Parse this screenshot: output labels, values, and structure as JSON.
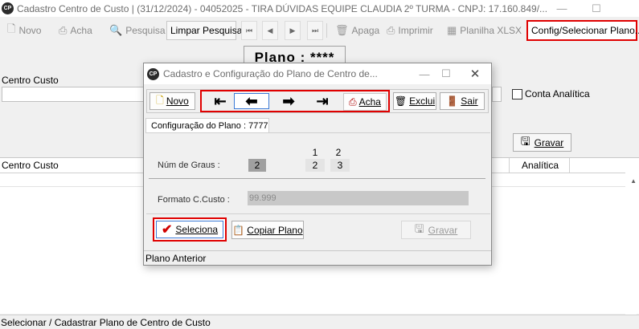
{
  "window": {
    "title": "Cadastro Centro de Custo | (31/12/2024) - 04052025 - TIRA DÚVIDAS EQUIPE CLAUDIA 2º TURMA   - CNPJ: 17.160.849/...",
    "minimize": "—",
    "maximize": "☐",
    "logo": "CP"
  },
  "toolbar": {
    "novo": "Novo",
    "acha": "Acha",
    "pesquisa": "Pesquisa",
    "limpar_pesquisa": "Limpar Pesquisa",
    "apaga": "Apaga",
    "imprimir": "Imprimir",
    "planilha": "Planilha XLSX",
    "config": "Config/Selecionar Plano..."
  },
  "main": {
    "plano_tab": "Plano : ****",
    "centro_custo_label": "Centro Custo",
    "conta_analitica": "Conta Analítica",
    "gravar": "Gravar",
    "grid_columns": [
      "Centro Custo",
      "Analítica"
    ]
  },
  "status_bar": "Selecionar / Cadastrar Plano de Centro de Custo",
  "dialog": {
    "title": "Cadastro e Configuração do Plano de Centro de...",
    "toolbar": {
      "novo": "Novo",
      "acha": "Acha",
      "exclui": "Exclui",
      "sair": "Sair"
    },
    "tab": "Configuração do Plano : 7777",
    "num_graus_label": "Núm de Graus :",
    "num_graus_value": "2",
    "grau_headers": [
      "1",
      "2"
    ],
    "grau_values": [
      "2",
      "3"
    ],
    "formato_label": "Formato C.Custo :",
    "formato_value": "99.999",
    "seleciona": "Seleciona",
    "copiar_plano": "Copiar Plano",
    "gravar": "Gravar",
    "status": "Plano Anterior"
  },
  "colors": {
    "highlight": "#e00000",
    "focus": "#3d7bd6"
  }
}
